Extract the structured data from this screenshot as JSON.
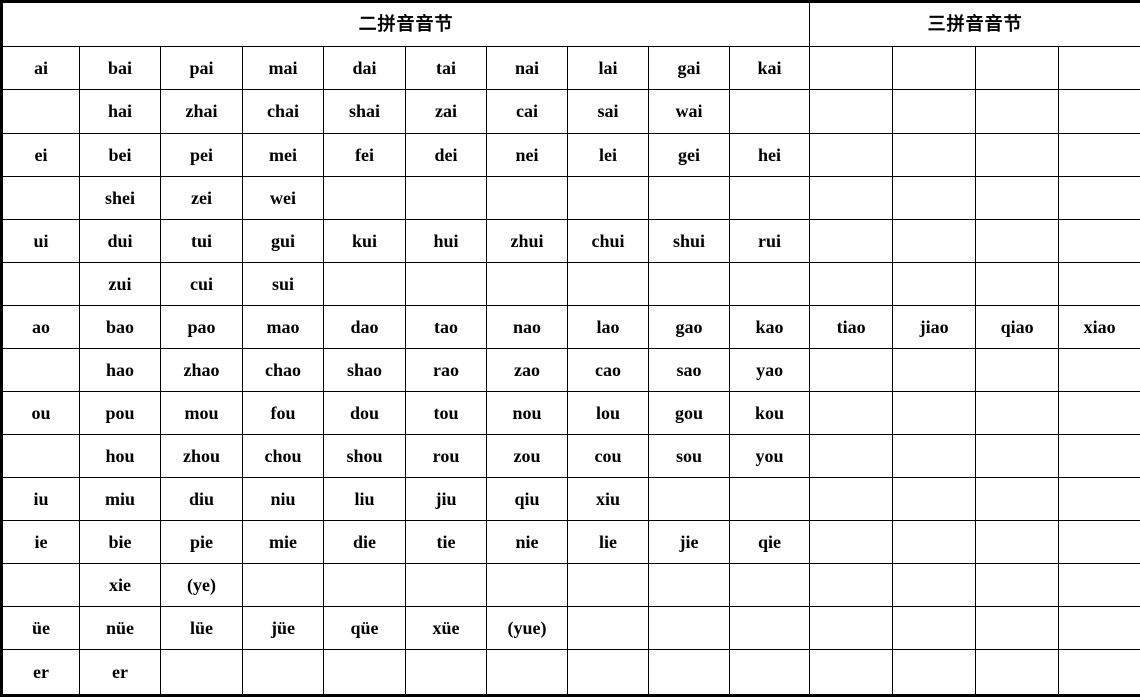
{
  "document": {
    "title": "拼音音节表"
  },
  "headers": {
    "two_part": "二拼音音节",
    "three_part": "三拼音音节"
  },
  "layout": {
    "left_columns": 10,
    "right_columns": 4,
    "rows": 15,
    "border_color": "#000000",
    "background": "#ffffff",
    "text_color": "#000000"
  },
  "rows": [
    {
      "id": "row-ai-1",
      "left": [
        "ai",
        "bai",
        "pai",
        "mai",
        "dai",
        "tai",
        "nai",
        "lai",
        "gai",
        "kai"
      ],
      "right": [
        "",
        "",
        "",
        ""
      ]
    },
    {
      "id": "row-ai-2",
      "left": [
        "",
        "hai",
        "zhai",
        "chai",
        "shai",
        "zai",
        "cai",
        "sai",
        "wai",
        ""
      ],
      "right": [
        "",
        "",
        "",
        ""
      ]
    },
    {
      "id": "row-ei-1",
      "left": [
        "ei",
        "bei",
        "pei",
        "mei",
        "fei",
        "dei",
        "nei",
        "lei",
        "gei",
        "hei"
      ],
      "right": [
        "",
        "",
        "",
        ""
      ]
    },
    {
      "id": "row-ei-2",
      "left": [
        "",
        "shei",
        "zei",
        "wei",
        "",
        "",
        "",
        "",
        "",
        ""
      ],
      "right": [
        "",
        "",
        "",
        ""
      ]
    },
    {
      "id": "row-ui-1",
      "left": [
        "ui",
        "dui",
        "tui",
        "gui",
        "kui",
        "hui",
        "zhui",
        "chui",
        "shui",
        "rui"
      ],
      "right": [
        "",
        "",
        "",
        ""
      ]
    },
    {
      "id": "row-ui-2",
      "left": [
        "",
        "zui",
        "cui",
        "sui",
        "",
        "",
        "",
        "",
        "",
        ""
      ],
      "right": [
        "",
        "",
        "",
        ""
      ]
    },
    {
      "id": "row-ao-1",
      "left": [
        "ao",
        "bao",
        "pao",
        "mao",
        "dao",
        "tao",
        "nao",
        "lao",
        "gao",
        "kao"
      ],
      "right": [
        "tiao",
        "jiao",
        "qiao",
        "xiao"
      ]
    },
    {
      "id": "row-ao-2",
      "left": [
        "",
        "hao",
        "zhao",
        "chao",
        "shao",
        "rao",
        "zao",
        "cao",
        "sao",
        "yao"
      ],
      "right": [
        "",
        "",
        "",
        ""
      ]
    },
    {
      "id": "row-ou-1",
      "left": [
        "ou",
        "pou",
        "mou",
        "fou",
        "dou",
        "tou",
        "nou",
        "lou",
        "gou",
        "kou"
      ],
      "right": [
        "",
        "",
        "",
        ""
      ]
    },
    {
      "id": "row-ou-2",
      "left": [
        "",
        "hou",
        "zhou",
        "chou",
        "shou",
        "rou",
        "zou",
        "cou",
        "sou",
        "you"
      ],
      "right": [
        "",
        "",
        "",
        ""
      ]
    },
    {
      "id": "row-iu",
      "left": [
        "iu",
        "miu",
        "diu",
        "niu",
        "liu",
        "jiu",
        "qiu",
        "xiu",
        "",
        ""
      ],
      "right": [
        "",
        "",
        "",
        ""
      ]
    },
    {
      "id": "row-ie-1",
      "left": [
        "ie",
        "bie",
        "pie",
        "mie",
        "die",
        "tie",
        "nie",
        "lie",
        "jie",
        "qie"
      ],
      "right": [
        "",
        "",
        "",
        ""
      ]
    },
    {
      "id": "row-ie-2",
      "left": [
        "",
        "xie",
        "(ye)",
        "",
        "",
        "",
        "",
        "",
        "",
        ""
      ],
      "right": [
        "",
        "",
        "",
        ""
      ]
    },
    {
      "id": "row-ue",
      "left": [
        "üe",
        "nüe",
        "lüe",
        "jüe",
        "qüe",
        "xüe",
        "(yue)",
        "",
        "",
        ""
      ],
      "right": [
        "",
        "",
        "",
        ""
      ]
    },
    {
      "id": "row-er",
      "left": [
        "er",
        "er",
        "",
        "",
        "",
        "",
        "",
        "",
        "",
        ""
      ],
      "right": [
        "",
        "",
        "",
        ""
      ]
    }
  ]
}
